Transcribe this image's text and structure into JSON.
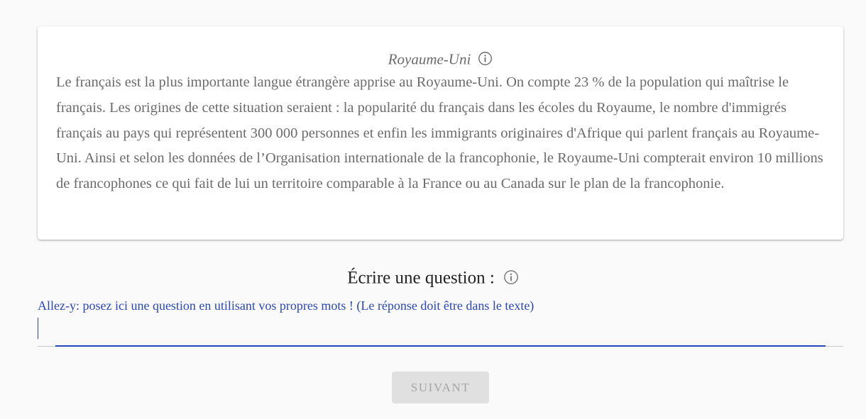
{
  "passage": {
    "title": "Royaume-Uni",
    "text": "Le français est la plus importante langue étrangère apprise au Royaume-Uni. On compte 23 % de la population qui maîtrise le français. Les origines de cette situation seraient : la popularité du français dans les écoles du Royaume, le nombre d'immigrés français au pays qui représentent 300 000 personnes et enfin les immigrants originaires d'Afrique qui parlent français au Royaume-Uni. Ainsi et selon les données de l’Organisation internationale de la francophonie, le Royaume-Uni compterait environ 10 millions de francophones ce qui fait de lui un territoire comparable à la France ou au Canada sur le plan de la francophonie.",
    "info_icon": "info-circle-icon"
  },
  "question": {
    "heading": "Écrire une question :",
    "info_icon": "info-circle-icon",
    "label": "Allez-y: posez ici une question en utilisant vos propres mots ! (Le réponse doit être dans le texte)",
    "value": ""
  },
  "actions": {
    "next_label": "Suivant",
    "next_disabled": true
  },
  "colors": {
    "accent": "#2a47b8",
    "passage_text": "#6b6b6b",
    "background": "#fafafa",
    "button_disabled_bg": "#e0e0e0",
    "button_disabled_text": "#a6a6a6"
  }
}
